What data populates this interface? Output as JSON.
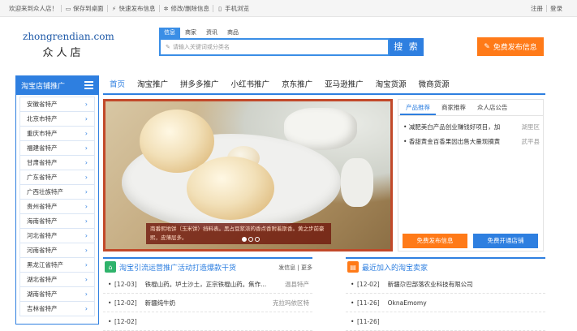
{
  "topbar": {
    "welcome": "欢迎来到众人店！",
    "save_desktop": "保存到桌面",
    "quick_publish": "快速发布信息",
    "edit_delete": "修改/删除信息",
    "mobile": "手机浏览",
    "register": "注册",
    "login": "登录"
  },
  "logo": {
    "en": "zhongrendian.com",
    "cn": "众人店"
  },
  "search": {
    "tabs": [
      "信息",
      "商家",
      "资讯",
      "商品"
    ],
    "placeholder": "请输入关键词或分类名",
    "button": "搜 索"
  },
  "publish_button": "免费发布信息",
  "nav": [
    "首页",
    "淘宝推广",
    "拼多多推广",
    "小红书推广",
    "京东推广",
    "亚马逊推广",
    "淘宝货源",
    "微商货源"
  ],
  "sidebar": {
    "title": "淘宝店铺推广",
    "items": [
      "安徽省特产",
      "北京市特产",
      "重庆市特产",
      "福建省特产",
      "甘肃省特产",
      "广东省特产",
      "广西壮族特产",
      "贵州省特产",
      "海南省特产",
      "河北省特产",
      "河南省特产",
      "黑龙江省特产",
      "湖北省特产",
      "湖南省特产",
      "吉林省特产"
    ]
  },
  "banner": {
    "caption": "南番熙地饼（玉米饼）挡料表。黑占豆浆浓的香点香附着斯香。黄之步前豪熙，皮薄层多。",
    "dots": 3,
    "active_dot": 1
  },
  "right_panel": {
    "tabs": [
      "产品推荐",
      "商家推荐",
      "众人店公告"
    ],
    "items": [
      {
        "title": "减肥美白产品创业赚钱好项目，加",
        "city": "湖里区"
      },
      {
        "title": "香甜黄金百香果因出售大量现摘黄",
        "city": "武平县"
      }
    ],
    "btn_publish": "免费发布信息",
    "btn_shop": "免费开通店铺"
  },
  "news_panel": {
    "title": "淘宝引流运营推广活动打造爆款干货",
    "more_label": "发信息 | 更多",
    "rows": [
      {
        "date": "[12-03]",
        "name": "铁棍山药。垆土沙土，正宗铁棍山药。焦作...",
        "loc": "温县特产"
      },
      {
        "date": "[12-02]",
        "name": "新疆纯牛奶",
        "loc": "克拉玛依区特"
      },
      {
        "date": "[12-02]",
        "name": "",
        "loc": ""
      }
    ]
  },
  "sellers_panel": {
    "title": "最近加入的淘宝卖家",
    "rows": [
      {
        "date": "[12-02]",
        "name": "新疆尕巴部落农业科技有限公司"
      },
      {
        "date": "[11-26]",
        "name": "OknaEmomy"
      },
      {
        "date": "[11-26]",
        "name": ""
      }
    ]
  },
  "colors": {
    "primary": "#2e7fe0",
    "accent": "#ff7a18",
    "banner_frame": "#c2492a"
  }
}
